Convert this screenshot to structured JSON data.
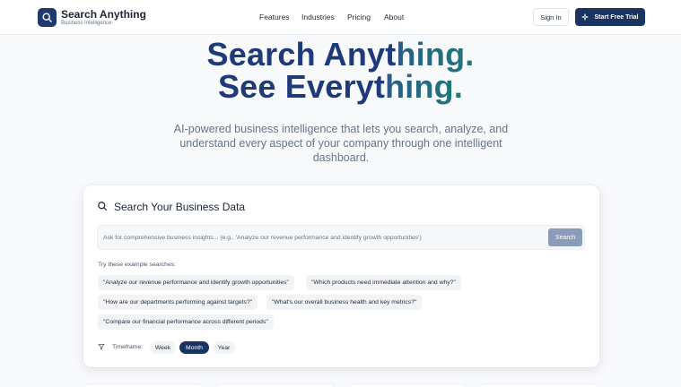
{
  "brand": {
    "title": "Search Anything",
    "subtitle": "Business Intelligence",
    "logo_icon": "search-icon"
  },
  "nav": {
    "items": [
      "Features",
      "Industries",
      "Pricing",
      "About"
    ]
  },
  "header_actions": {
    "sign_in": "Sign In",
    "trial": "Start Free Trial",
    "trial_icon": "sparkle-icon"
  },
  "hero": {
    "line1_a": "Search Anyt",
    "line1_b": "hing.",
    "line2_a": "See Everyt",
    "line2_b": "hing.",
    "description": "AI-powered business intelligence that lets you search, analyze, and understand every aspect of your company through one intelligent dashboard."
  },
  "search_card": {
    "title": "Search Your Business Data",
    "title_icon": "search-icon",
    "placeholder": "Ask for comprehensive business insights... (e.g., 'Analyze our revenue performance and identify growth opportunities')",
    "value": "",
    "button": "Search",
    "examples_label": "Try these example searches:",
    "examples": [
      "\"Analyze our revenue performance and identify growth opportunities\"",
      "\"Which products need immediate attention and why?\"",
      "\"How are our departments performing against targets?\"",
      "\"What's our overall business health and key metrics?\"",
      "\"Compare our financial performance across different periods\""
    ],
    "timeframe_label": "Timeframe:",
    "timeframe_icon": "filter-icon",
    "timeframes": [
      "Week",
      "Month",
      "Year"
    ],
    "selected_timeframe": "Month"
  },
  "colors": {
    "primary": "#1a3462",
    "accent_gradient_start": "#2b5a87",
    "accent_gradient_end": "#1f7a78",
    "search_button": "#8b9cba"
  }
}
